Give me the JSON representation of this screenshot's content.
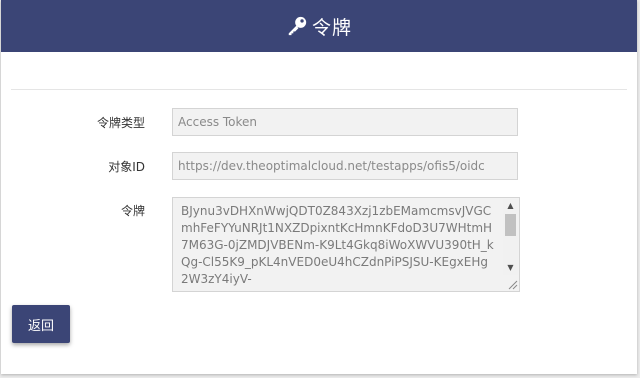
{
  "header": {
    "title": "令牌",
    "icon": "key-icon",
    "background": "#3b4576"
  },
  "form": {
    "token_type": {
      "label": "令牌类型",
      "value": "Access Token"
    },
    "audience": {
      "label": "对象ID",
      "value": "https://dev.theoptimalcloud.net/testapps/ofis5/oidc"
    },
    "token": {
      "label": "令牌",
      "value": "BJynu3vDHXnWwjQDT0Z843Xzj1zbEMamcmsvJVGCmhFeFYYuNRJt1NXZDpixntKcHmnKFdoD3U7WHtmH7M63G-0jZMDJVBENm-K9Lt4Gkq8iWoXWVU390tH_kQg-Cl55K9_pKL4nVED0eU4hCZdnPiPSJSU-KEgxEHg2W3zY4iyV-"
    }
  },
  "actions": {
    "back_label": "返回"
  }
}
